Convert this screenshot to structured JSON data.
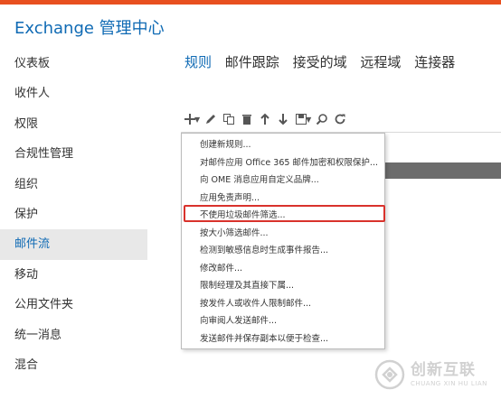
{
  "app": {
    "title": "Exchange 管理中心"
  },
  "colors": {
    "accent": "#0f6ab4",
    "topbar": "#e8501f",
    "highlight": "#d9322c"
  },
  "sidebar": {
    "items": [
      {
        "label": "仪表板"
      },
      {
        "label": "收件人"
      },
      {
        "label": "权限"
      },
      {
        "label": "合规性管理"
      },
      {
        "label": "组织"
      },
      {
        "label": "保护"
      },
      {
        "label": "邮件流",
        "active": true
      },
      {
        "label": "移动"
      },
      {
        "label": "公用文件夹"
      },
      {
        "label": "统一消息"
      },
      {
        "label": "混合"
      }
    ]
  },
  "tabs": [
    {
      "label": "规则",
      "active": true
    },
    {
      "label": "邮件跟踪"
    },
    {
      "label": "接受的域"
    },
    {
      "label": "远程域"
    },
    {
      "label": "连接器"
    }
  ],
  "toolbar": {
    "icons": [
      "add-icon",
      "edit-icon",
      "copy-icon",
      "delete-icon",
      "move-up-icon",
      "move-down-icon",
      "save-icon",
      "search-icon",
      "refresh-icon"
    ]
  },
  "menu": {
    "items": [
      "创建新规则...",
      "对邮件应用 Office 365 邮件加密和权限保护...",
      "向 OME 消息应用自定义品牌...",
      "应用免责声明...",
      "不使用垃圾邮件筛选...",
      "按大小筛选邮件...",
      "检测到敏感信息时生成事件报告...",
      "修改邮件...",
      "限制经理及其直接下属...",
      "按发件人或收件人限制邮件...",
      "向审阅人发送邮件...",
      "发送邮件并保存副本以便于检查..."
    ],
    "highlighted_index": 4
  },
  "watermark": {
    "main": "创新互联",
    "sub": "CHUANG XIN HU LIAN"
  }
}
